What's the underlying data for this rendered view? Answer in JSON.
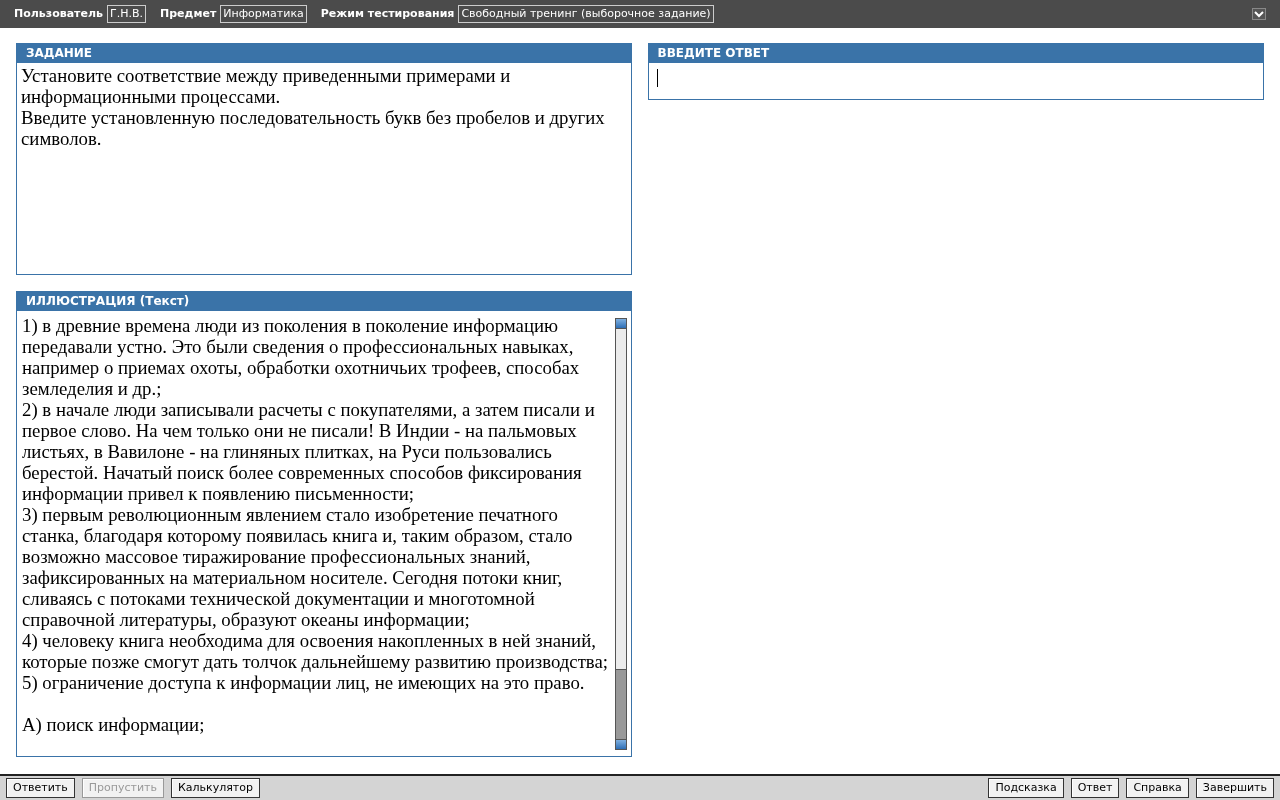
{
  "header": {
    "fields": [
      {
        "label": "Пользователь",
        "value": "Г.Н.В."
      },
      {
        "label": "Предмет",
        "value": "Информатика"
      },
      {
        "label": "Режим тестирования",
        "value": "Свободный тренинг (выборочное задание)"
      }
    ]
  },
  "task": {
    "title": "ЗАДАНИЕ",
    "paragraphs": [
      "Установите соответствие между приведенными примерами и информационными процессами.",
      "Введите установленную последовательность букв без пробелов и других символов."
    ]
  },
  "illustration": {
    "title": "ИЛЛЮСТРАЦИЯ (Текст)",
    "paragraphs": [
      "1) в древние времена люди из поколения в поколение информацию передавали устно. Это были сведения о профессиональных навыках, например о приемах охоты, обработки охотничьих трофеев, способах земледелия и др.;",
      "2) в начале люди записывали расчеты с покупателями, а затем писали и первое слово. На чем только они не писали! В Индии - на пальмовых листьях, в Вавилоне - на глиняных плитках, на Руси пользовались берестой. Начатый поиск более современных способов фиксирования информации привел к появлению письменности;",
      "3) первым революционным явлением стало изобретение печатного станка, благодаря которому появилась книга и, таким образом, стало возможно массовое тиражирование профессиональных знаний, зафиксированных на материальном носителе. Сегодня потоки книг, сливаясь с потоками технической документации и многотомной справочной литературы, образуют океаны информации;",
      "4) человеку книга необходима для освоения накопленных в ней знаний, которые позже смогут дать толчок дальнейшему развитию производства;",
      "5) ограничение доступа к информации лиц, не имеющих на это право."
    ],
    "options": [
      "А) поиск информации;"
    ]
  },
  "answer": {
    "title": "ВВЕДИТЕ ОТВЕТ"
  },
  "footer": {
    "left_buttons": [
      {
        "label": "Ответить",
        "disabled": false
      },
      {
        "label": "Пропустить",
        "disabled": true
      },
      {
        "label": "Калькулятор",
        "disabled": false
      }
    ],
    "right_buttons": [
      {
        "label": "Подсказка",
        "disabled": false
      },
      {
        "label": "Ответ",
        "disabled": false
      },
      {
        "label": "Справка",
        "disabled": false
      },
      {
        "label": "Завершить",
        "disabled": false
      }
    ]
  }
}
